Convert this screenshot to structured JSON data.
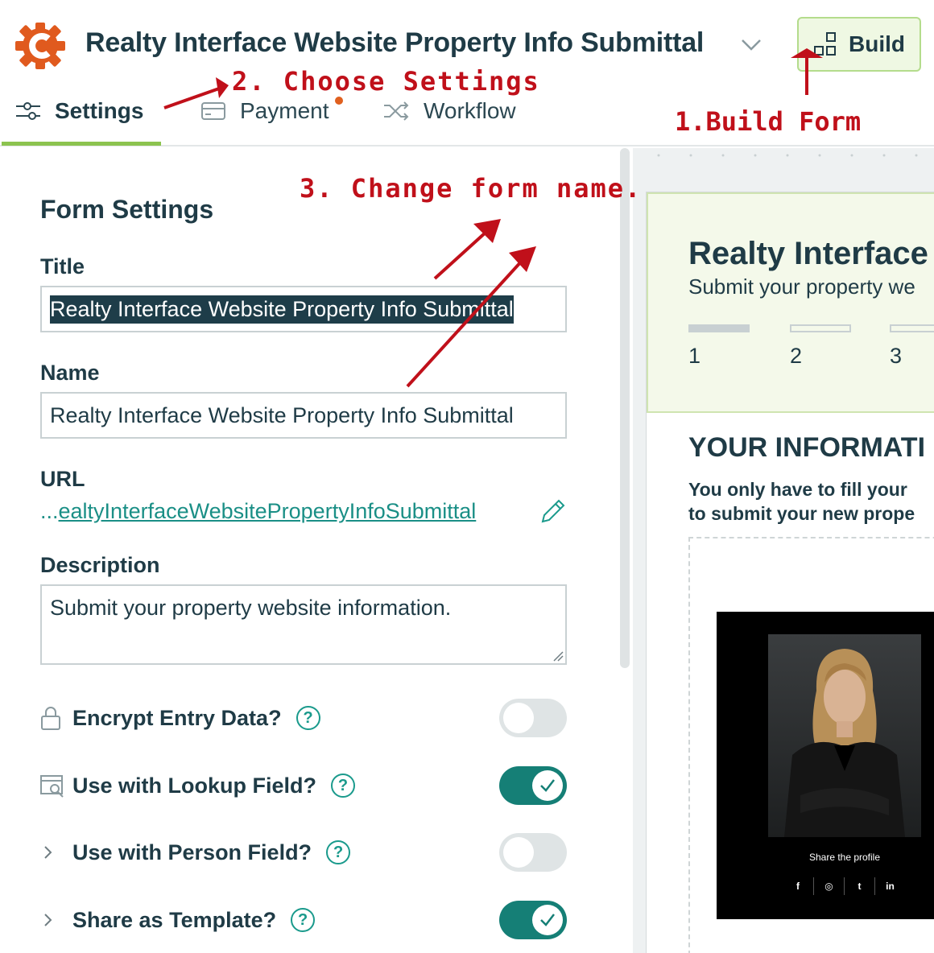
{
  "header": {
    "form_title": "Realty Interface Website Property Info Submittal",
    "build_label": "Build",
    "tabs": [
      {
        "label": "Settings",
        "active": true
      },
      {
        "label": "Payment"
      },
      {
        "label": "Workflow"
      }
    ]
  },
  "annotations": {
    "step1": "1.Build Form",
    "step2": "2. Choose Settings",
    "step3": "3. Change form name."
  },
  "settings": {
    "heading": "Form Settings",
    "title_label": "Title",
    "title_value": "Realty Interface Website Property Info Submittal",
    "name_label": "Name",
    "name_value": "Realty Interface Website Property Info Submittal",
    "url_label": "URL",
    "url_prefix": "...",
    "url_value": "ealtyInterfaceWebsitePropertyInfoSubmittal",
    "description_label": "Description",
    "description_value": "Submit your property website information.",
    "toggles": [
      {
        "label": "Encrypt Entry Data?",
        "on": false,
        "icon": "lock-icon"
      },
      {
        "label": "Use with Lookup Field?",
        "on": true,
        "icon": "lookup-icon"
      },
      {
        "label": "Use with Person Field?",
        "on": false,
        "icon": "chevron-right-icon"
      },
      {
        "label": "Share as Template?",
        "on": true,
        "icon": "chevron-right-icon"
      }
    ],
    "help_glyph": "?"
  },
  "preview": {
    "title": "Realty Interface",
    "subtitle": "Submit your property we",
    "steps": [
      "1",
      "2",
      "3"
    ],
    "section_title": "YOUR INFORMATI",
    "intro_line1": "You only have to fill your",
    "intro_line2": "to submit your new prope",
    "share_text": "Share the profile",
    "social": [
      "f",
      "◎",
      "t",
      "in"
    ]
  },
  "colors": {
    "accent_green": "#8cc34f",
    "teal": "#157f76",
    "annotation_red": "#c0101a",
    "logo_orange": "#e05a1e"
  }
}
